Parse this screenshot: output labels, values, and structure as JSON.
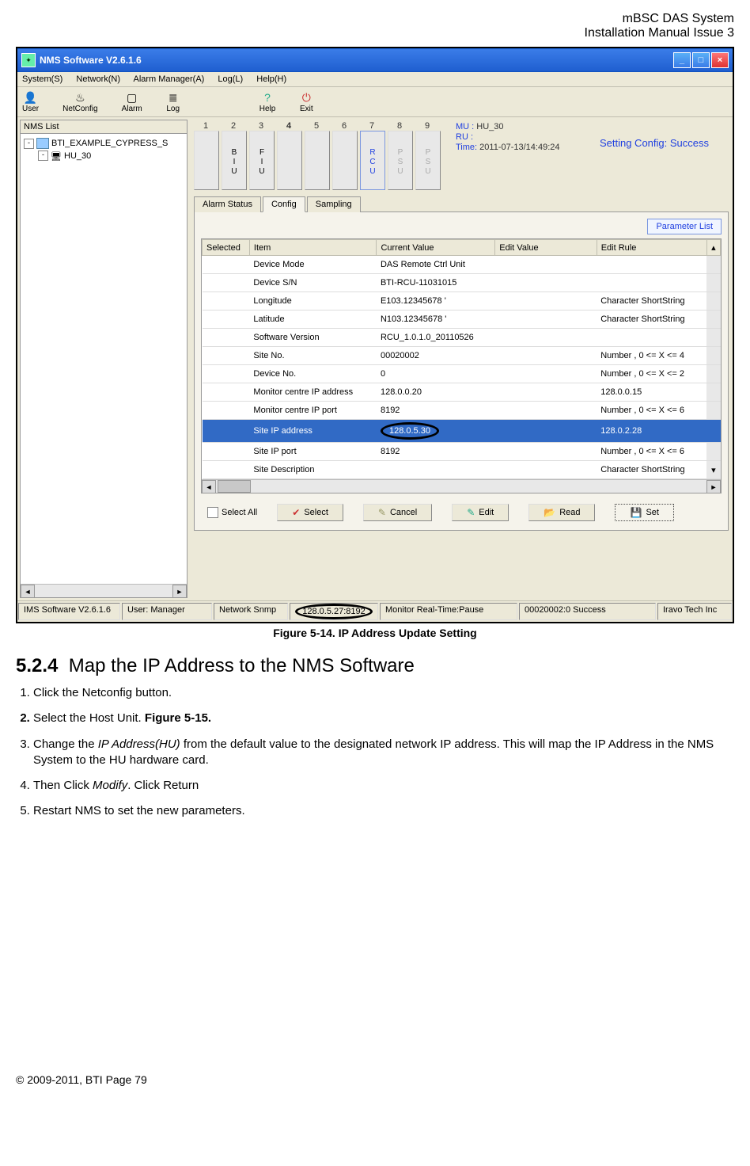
{
  "header": {
    "line1": "mBSC DAS System",
    "line2": "Installation Manual Issue 3"
  },
  "window": {
    "title": "NMS Software V2.6.1.6",
    "menus": [
      "System(S)",
      "Network(N)",
      "Alarm Manager(A)",
      "Log(L)",
      "Help(H)"
    ],
    "toolbar": [
      {
        "label": "User",
        "glyph": "👤"
      },
      {
        "label": "NetConfig",
        "glyph": "🔧"
      },
      {
        "label": "Alarm",
        "glyph": "▢"
      },
      {
        "label": "Log",
        "glyph": "≡"
      },
      {
        "label": "Help",
        "glyph": "?"
      },
      {
        "label": "Exit",
        "glyph": "⎋"
      }
    ],
    "sidebar": {
      "title": "NMS List",
      "root": "BTI_EXAMPLE_CYPRESS_S",
      "child": "HU_30"
    },
    "slots": {
      "numbers": [
        "1",
        "2",
        "3",
        "4",
        "5",
        "6",
        "7",
        "8",
        "9"
      ],
      "cards": [
        {
          "idx": 2,
          "lines": [
            "B",
            "I",
            "U"
          ],
          "cls": ""
        },
        {
          "idx": 3,
          "lines": [
            "F",
            "I",
            "U"
          ],
          "cls": ""
        },
        {
          "idx": 7,
          "lines": [
            "R",
            "C",
            "U"
          ],
          "cls": "active",
          "color": "#2040e0"
        },
        {
          "idx": 8,
          "lines": [
            "P",
            "S",
            "U"
          ],
          "cls": "dim"
        },
        {
          "idx": 9,
          "lines": [
            "P",
            "S",
            "U"
          ],
          "cls": "dim"
        }
      ]
    },
    "info": {
      "mu_label": "MU :",
      "mu_value": "HU_30",
      "ru_label": "RU :",
      "ru_value": "",
      "time_label": "Time:",
      "time_value": "2011-07-13/14:49:24"
    },
    "status_msg": "Setting Config: Success",
    "tabs": [
      "Alarm Status",
      "Config",
      "Sampling"
    ],
    "active_tab": "Config",
    "param_button": "Parameter List",
    "grid": {
      "headers": [
        "Selected",
        "Item",
        "Current Value",
        "Edit Value",
        "Edit Rule"
      ],
      "rows": [
        {
          "item": "Device Mode",
          "cur": "DAS Remote Ctrl Unit",
          "edit": "",
          "rule": ""
        },
        {
          "item": "Device S/N",
          "cur": "BTI-RCU-11031015",
          "edit": "",
          "rule": ""
        },
        {
          "item": "Longitude",
          "cur": "E103.12345678 '",
          "edit": "",
          "rule": "Character ShortString"
        },
        {
          "item": "Latitude",
          "cur": "N103.12345678 '",
          "edit": "",
          "rule": "Character ShortString"
        },
        {
          "item": "Software Version",
          "cur": "RCU_1.0.1.0_20110526",
          "edit": "",
          "rule": ""
        },
        {
          "item": "Site No.",
          "cur": "00020002",
          "edit": "",
          "rule": "Number , 0 <= X <= 4"
        },
        {
          "item": "Device No.",
          "cur": "0",
          "edit": "",
          "rule": "Number , 0 <= X <= 2"
        },
        {
          "item": "Monitor centre IP address",
          "cur": "128.0.0.20",
          "edit": "",
          "rule": "128.0.0.15"
        },
        {
          "item": "Monitor centre IP port",
          "cur": "8192",
          "edit": "",
          "rule": "Number , 0 <= X <= 6"
        },
        {
          "item": "Site IP address",
          "cur": "128.0.5.30",
          "edit": "",
          "rule": "128.0.2.28",
          "selected": true,
          "oval": true
        },
        {
          "item": "Site IP port",
          "cur": "8192",
          "edit": "",
          "rule": "Number , 0 <= X <= 6"
        },
        {
          "item": "Site Description",
          "cur": "",
          "edit": "",
          "rule": "Character ShortString"
        }
      ]
    },
    "actions": {
      "select_all": "Select All",
      "select": "Select",
      "cancel": "Cancel",
      "edit": "Edit",
      "read": "Read",
      "set": "Set"
    },
    "statusbar": {
      "cells": [
        "IMS Software V2.6.1.6",
        "User: Manager",
        "Network Snmp",
        "128.0.5.27:8192",
        "Monitor Real-Time:Pause",
        "00020002:0 Success",
        "Iravo Tech Inc"
      ]
    }
  },
  "caption": "Figure 5-14. IP Address Update Setting",
  "section": {
    "number": "5.2.4",
    "title": "Map the IP Address to the NMS Software"
  },
  "steps": [
    {
      "pre": "",
      "text": "Click the Netconfig button."
    },
    {
      "pre": "",
      "text": "Select the Host Unit. ",
      "bold": "Figure 5-15."
    },
    {
      "pre": "Change the ",
      "italic": "IP Address(HU)",
      "post": " from the default value to the designated network IP address. This will map the IP Address in the NMS System to the HU hardware card."
    },
    {
      "pre": "Then Click ",
      "italic": "Modify",
      "post": ". Click Return"
    },
    {
      "pre": "",
      "text": "Restart NMS to set the new parameters."
    }
  ],
  "footer": "© 2009-2011, BTI Page 79"
}
